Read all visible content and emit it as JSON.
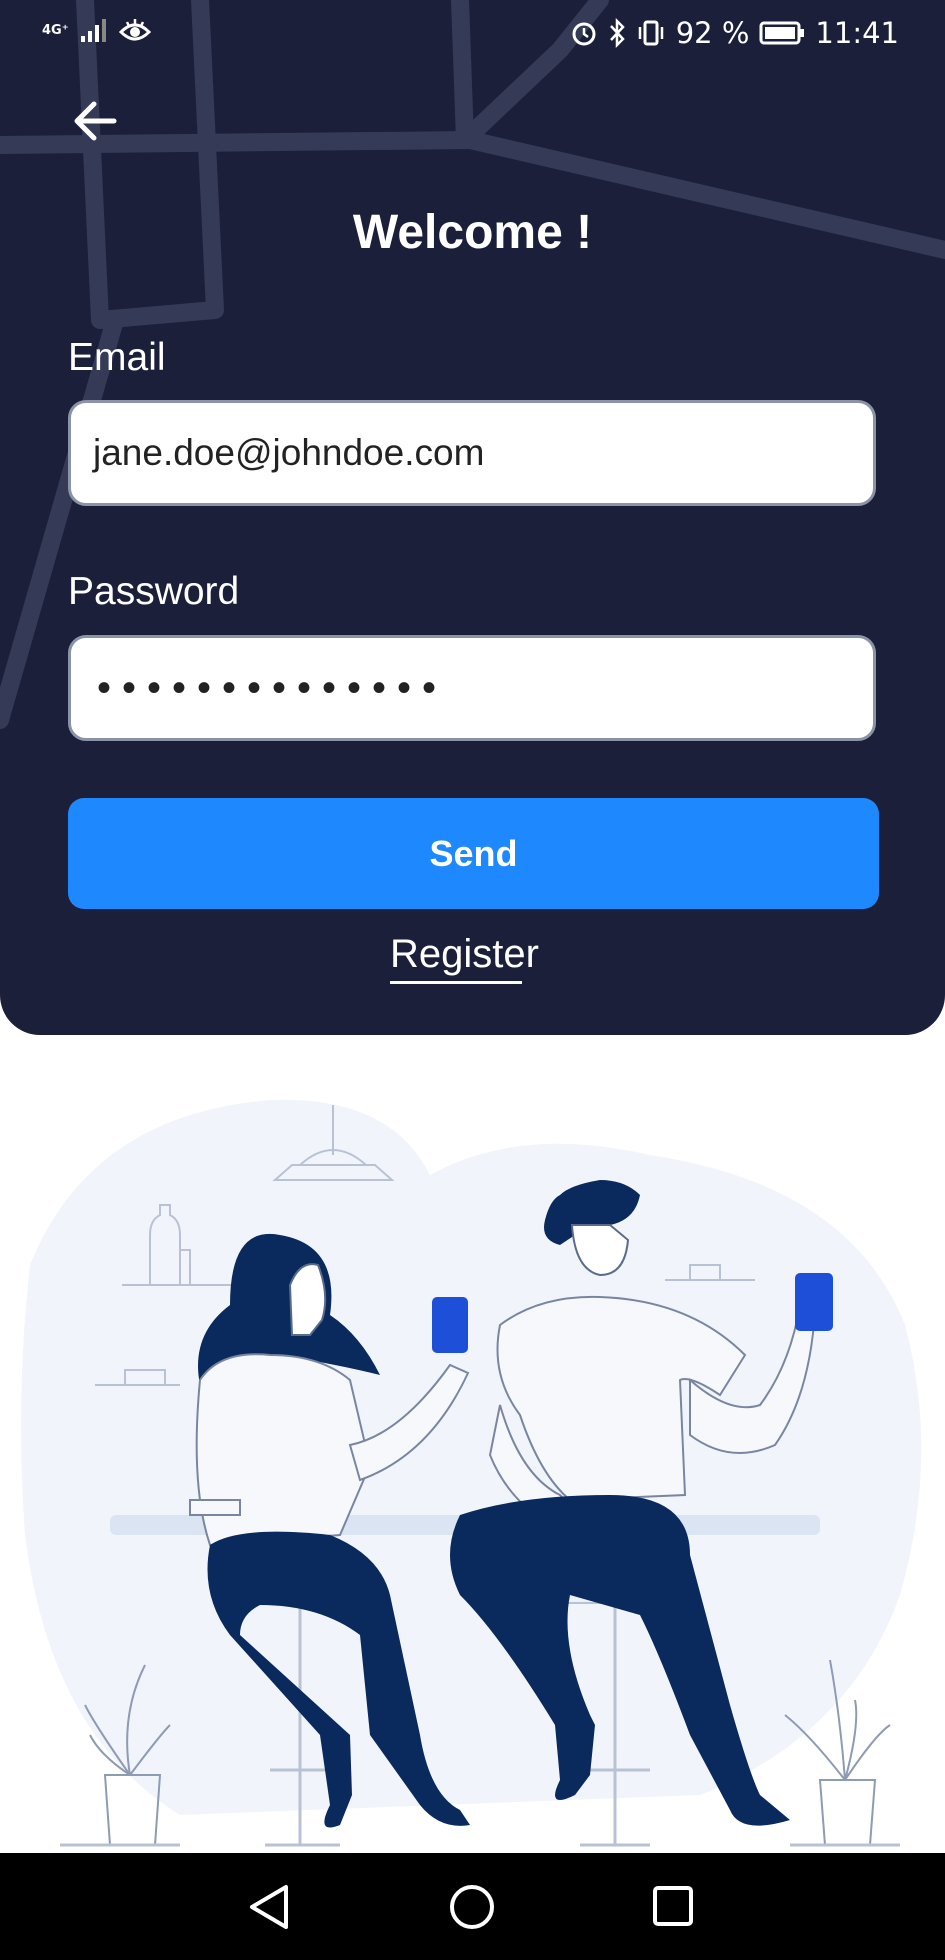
{
  "status_bar": {
    "network": "4G⁺",
    "battery_percent": "92 %",
    "time": "11:41"
  },
  "header": {
    "title": "Welcome !"
  },
  "form": {
    "email_label": "Email",
    "email_value": "jane.doe@johndoe.com",
    "password_label": "Password",
    "password_value": "••••••••••••••",
    "send_label": "Send",
    "register_label": "Register"
  },
  "icons": {
    "back": "back-arrow-icon",
    "alarm": "alarm-icon",
    "bluetooth": "bluetooth-icon",
    "vibrate": "vibrate-icon",
    "battery": "battery-icon",
    "eye": "eye-icon",
    "signal": "signal-icon",
    "nav_back": "triangle-back-icon",
    "nav_home": "circle-home-icon",
    "nav_recents": "square-recents-icon"
  },
  "colors": {
    "background": "#1b1f3a",
    "accent": "#1e88ff",
    "illustration_navy": "#0a2a5e",
    "illustration_blue": "#1d4fd9"
  }
}
